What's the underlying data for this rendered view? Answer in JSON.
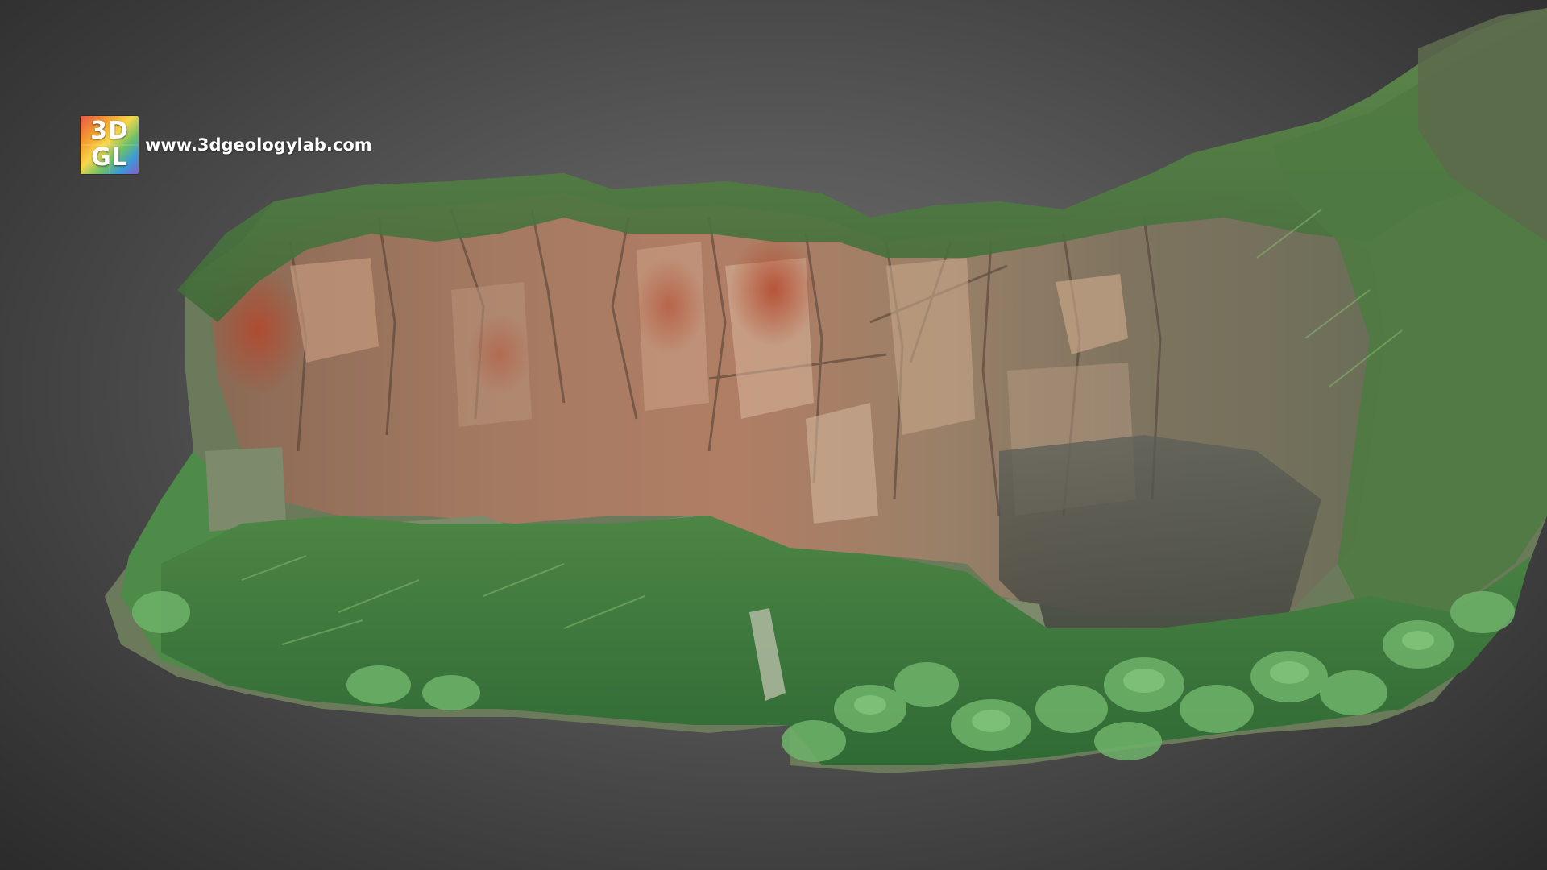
{
  "logo": {
    "line1": "3D",
    "line2": "GL"
  },
  "website": "www.3dgeologylab.com",
  "colors": {
    "background": "#5a5a5a",
    "rock": "#9c7a63",
    "rust": "#a5523a",
    "vegetation": "#4f8a45",
    "leaf": "#6fb36a",
    "mesh_base": "#7e8a6a"
  },
  "scene": {
    "subject": "photogrammetry rock outcrop model"
  }
}
